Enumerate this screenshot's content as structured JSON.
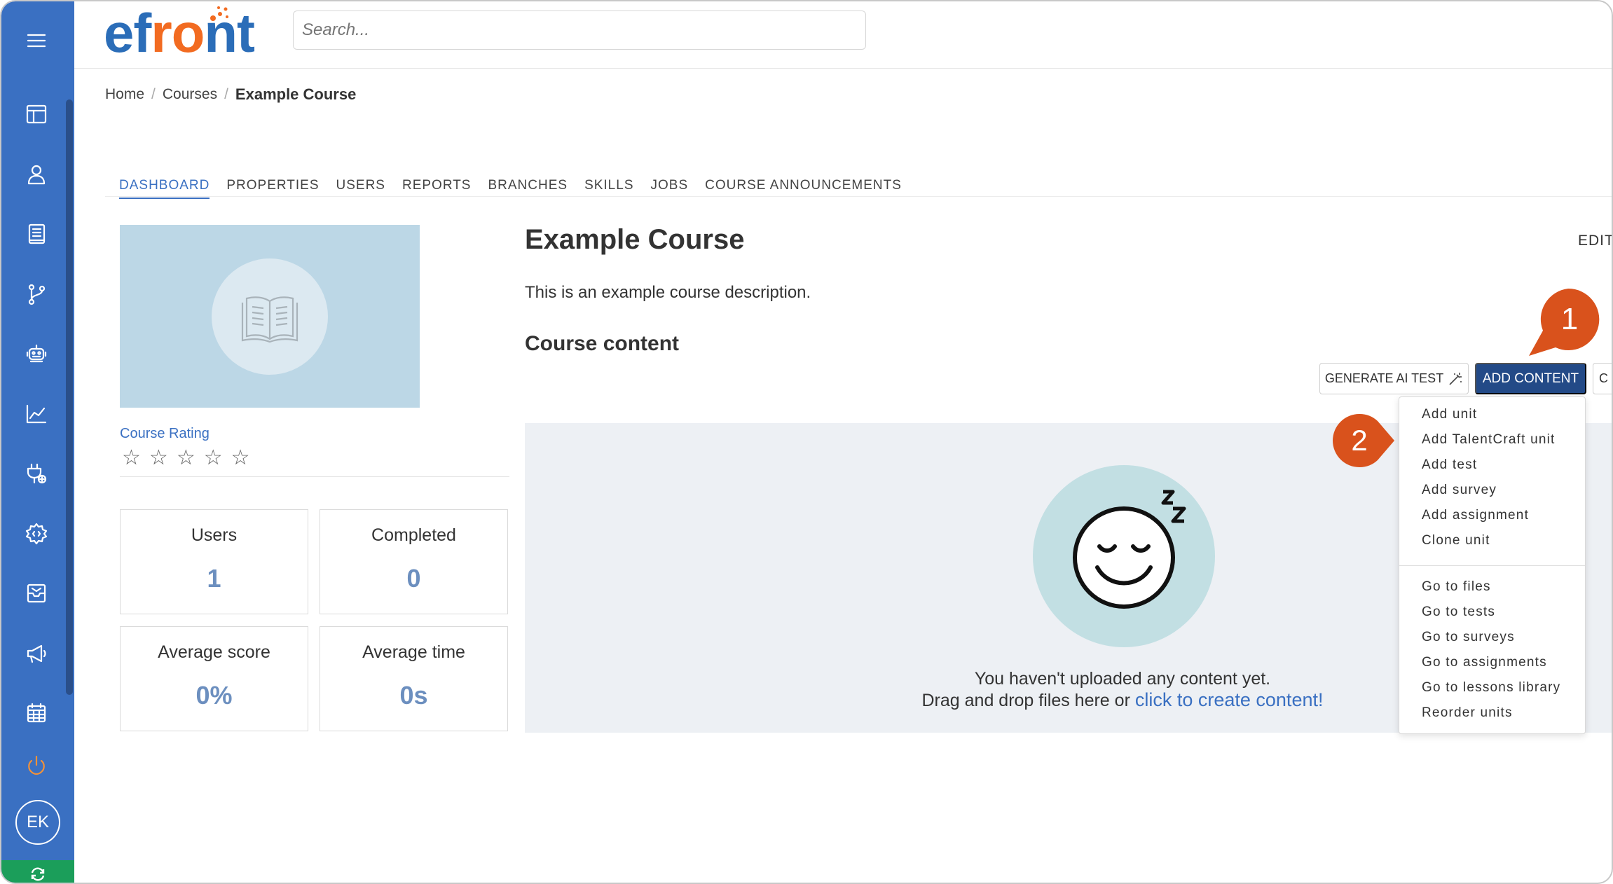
{
  "app": {
    "logo_text_a": "ef",
    "logo_text_b": "r",
    "logo_text_c": "o",
    "logo_text_d": "nt",
    "search_placeholder": "Search...",
    "avatar_initials": "EK"
  },
  "breadcrumb": {
    "items": [
      "Home",
      "Courses"
    ],
    "separator": "/",
    "current": "Example Course"
  },
  "tabs": [
    "DASHBOARD",
    "PROPERTIES",
    "USERS",
    "REPORTS",
    "BRANCHES",
    "SKILLS",
    "JOBS",
    "COURSE ANNOUNCEMENTS"
  ],
  "course": {
    "title": "Example Course",
    "description": "This is an example course description.",
    "edit_label": "EDIT",
    "content_heading": "Course content",
    "rating_label": "Course Rating",
    "stars": [
      "☆",
      "☆",
      "☆",
      "☆",
      "☆"
    ]
  },
  "stats": [
    {
      "label": "Users",
      "value": "1"
    },
    {
      "label": "Completed",
      "value": "0"
    },
    {
      "label": "Average score",
      "value": "0%"
    },
    {
      "label": "Average time",
      "value": "0s"
    }
  ],
  "toolbar": {
    "generate_label": "GENERATE AI TEST",
    "add_content_label": "ADD CONTENT",
    "more_label": "C"
  },
  "empty_state": {
    "line1": "You haven't uploaded any content yet.",
    "line2": "Drag and drop files here or",
    "link": "click to create content!"
  },
  "menu": {
    "group1": [
      "Add unit",
      "Add TalentCraft unit",
      "Add test",
      "Add survey",
      "Add assignment",
      "Clone unit"
    ],
    "group2": [
      "Go to files",
      "Go to tests",
      "Go to surveys",
      "Go to assignments",
      "Go to lessons library",
      "Reorder units"
    ]
  },
  "callouts": {
    "one": "1",
    "two": "2",
    "color": "#d9521c"
  },
  "colors": {
    "sidebar": "#3a70c2",
    "primary_button": "#234a87",
    "accent": "#3a70c2",
    "logo_orange": "#f26b21"
  }
}
